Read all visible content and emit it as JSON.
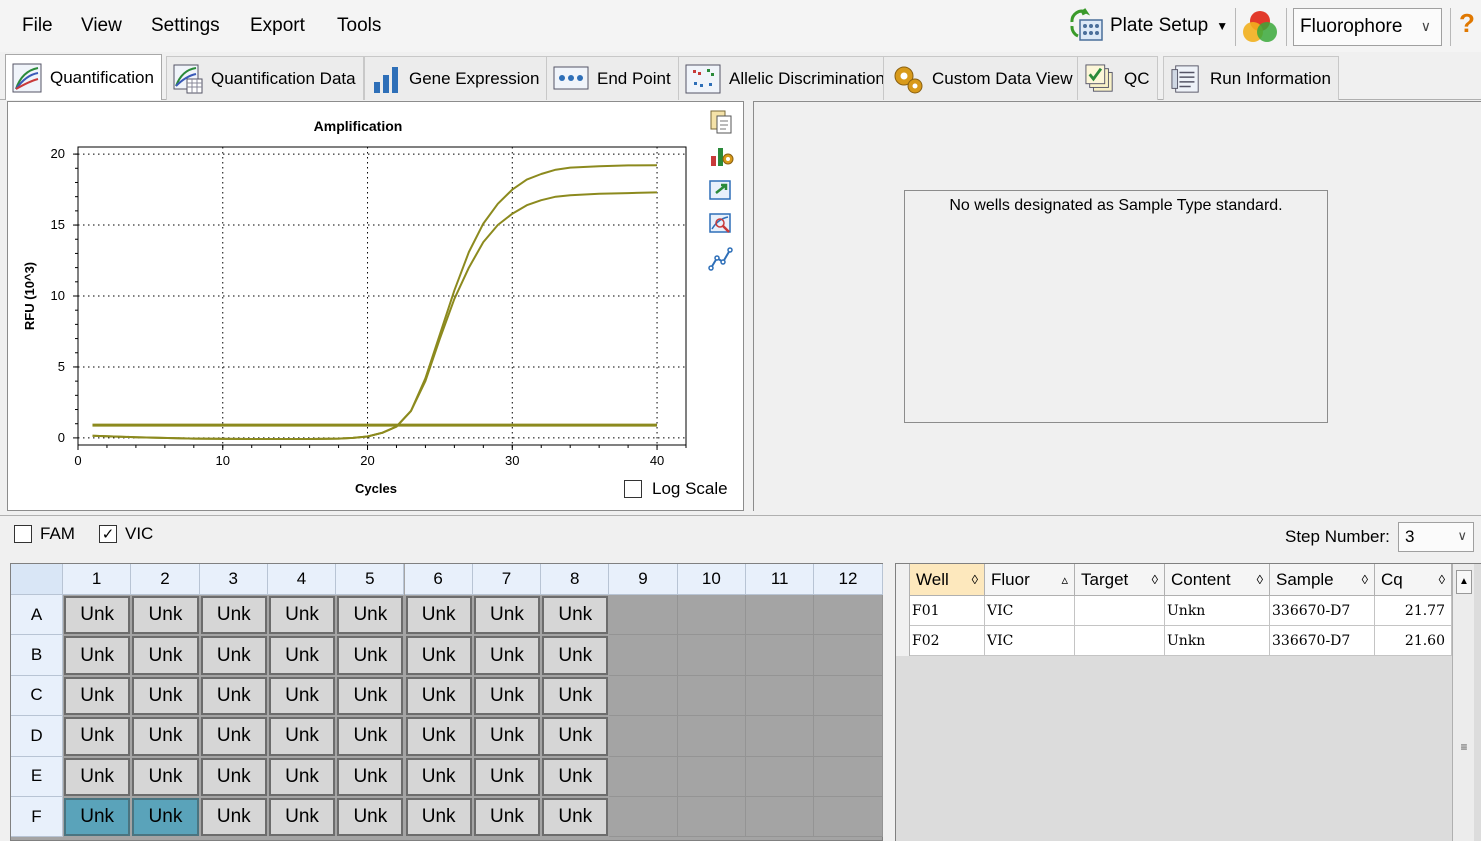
{
  "menu": {
    "items": [
      "File",
      "View",
      "Settings",
      "Export",
      "Tools"
    ],
    "plate_setup_label": "Plate Setup",
    "fluor_selector_value": "Fluorophore",
    "help_label": "?"
  },
  "tabs": [
    {
      "label": "Quantification",
      "icon": "quantification-icon",
      "active": true
    },
    {
      "label": "Quantification Data",
      "icon": "quant-data-icon"
    },
    {
      "label": "Gene Expression",
      "icon": "gene-expression-icon"
    },
    {
      "label": "End Point",
      "icon": "end-point-icon"
    },
    {
      "label": "Allelic Discrimination",
      "icon": "allelic-icon"
    },
    {
      "label": "Custom Data View",
      "icon": "custom-view-icon"
    },
    {
      "label": "QC",
      "icon": "qc-icon"
    },
    {
      "label": "Run Information",
      "icon": "run-info-icon"
    }
  ],
  "chart_data": {
    "type": "line",
    "title": "Amplification",
    "xlabel": "Cycles",
    "ylabel": "RFU (10^3)",
    "xlim": [
      0,
      42
    ],
    "ylim": [
      -0.5,
      20.5
    ],
    "xticks": [
      0,
      10,
      20,
      30,
      40
    ],
    "yticks": [
      0,
      5,
      10,
      15,
      20
    ],
    "grid": true,
    "log_scale": false,
    "line_color": "#8c8a1e",
    "threshold": {
      "y": 0.9,
      "x_range": [
        1,
        40
      ]
    },
    "series": [
      {
        "x": [
          1,
          4,
          8,
          12,
          16,
          18,
          19,
          20,
          21,
          22,
          23,
          24,
          25,
          26,
          27,
          28,
          29,
          30,
          31,
          32,
          33,
          34,
          36,
          38,
          40
        ],
        "y": [
          0.15,
          0.05,
          -0.05,
          -0.08,
          -0.08,
          -0.05,
          0.0,
          0.1,
          0.35,
          0.8,
          1.9,
          4.2,
          7.3,
          10.4,
          13.1,
          15.1,
          16.5,
          17.5,
          18.2,
          18.6,
          18.9,
          19.05,
          19.15,
          19.2,
          19.22
        ]
      },
      {
        "x": [
          1,
          4,
          8,
          12,
          16,
          18,
          19,
          20,
          21,
          22,
          23,
          24,
          25,
          26,
          27,
          28,
          29,
          30,
          31,
          32,
          33,
          34,
          36,
          38,
          40
        ],
        "y": [
          0.15,
          0.05,
          -0.05,
          -0.08,
          -0.08,
          -0.05,
          0.0,
          0.1,
          0.35,
          0.8,
          1.9,
          4.0,
          7.0,
          9.8,
          12.0,
          13.8,
          15.0,
          15.8,
          16.4,
          16.75,
          17.0,
          17.1,
          17.2,
          17.25,
          17.3
        ]
      }
    ]
  },
  "chart_tools": [
    "copy-icon",
    "chart-settings-icon",
    "export-icon",
    "zoom-icon",
    "series-icon"
  ],
  "log_scale_label": "Log Scale",
  "standard_curve_message": "No wells designated as Sample Type standard.",
  "fluors": [
    {
      "label": "FAM",
      "checked": false
    },
    {
      "label": "VIC",
      "checked": true
    }
  ],
  "step": {
    "label": "Step Number:",
    "value": "3"
  },
  "plate": {
    "columns": [
      "1",
      "2",
      "3",
      "4",
      "5",
      "6",
      "7",
      "8",
      "9",
      "10",
      "11",
      "12"
    ],
    "rows": [
      "A",
      "B",
      "C",
      "D",
      "E",
      "F"
    ],
    "well_label": "Unk",
    "filled_columns": 8,
    "selected_wells": [
      "F1",
      "F2"
    ]
  },
  "table": {
    "headers": [
      "Well",
      "Fluor",
      "Target",
      "Content",
      "Sample",
      "Cq"
    ],
    "rows": [
      {
        "well": "F01",
        "fluor": "VIC",
        "target": "",
        "content": "Unkn",
        "sample": "336670-D7",
        "cq": "21.77"
      },
      {
        "well": "F02",
        "fluor": "VIC",
        "target": "",
        "content": "Unkn",
        "sample": "336670-D7",
        "cq": "21.60"
      }
    ]
  }
}
